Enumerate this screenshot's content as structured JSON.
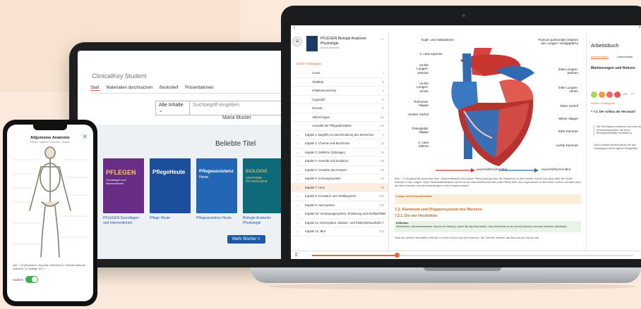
{
  "tablet": {
    "logo": "ClinicalKey",
    "logo_suffix": "Student",
    "nav": [
      "Start",
      "Materialien durchsuchen",
      "Bookshelf",
      "Präsentationen"
    ],
    "search_filter": "Alle Inhalte",
    "search_placeholder": "Suchbegriff eingeben",
    "user_name": "Maria Muster",
    "section_title": "Beliebte Titel",
    "books": [
      {
        "cover_title": "PFLEGEN",
        "cover_sub": "Grundlagen und Interventionen",
        "caption": "PFLEGEN Grundlagen und Interventionen",
        "color": "#6a2d85"
      },
      {
        "cover_title": "PflegeHeute",
        "cover_sub": "",
        "caption": "Pflege Heute",
        "color": "#1b4f9c"
      },
      {
        "cover_title": "Pflegeassistenz",
        "cover_sub": "Heute",
        "caption": "Pflegeassistenz Heute",
        "color": "#2366b5"
      },
      {
        "cover_title": "BIOLOGIE",
        "cover_sub": "ANATOMIE PHYSIOLOGIE",
        "caption": "Biologie Anatomie Physiologie",
        "color": "#0e6a78"
      }
    ],
    "more_button": "Mehr Bücher >"
  },
  "laptop": {
    "book_title": "PFLEGEN Biologie Anatomie Physiologie",
    "book_author": "Nicole Menche",
    "breadcrumb": "Inhalt > Einklappen",
    "toc": [
      {
        "label": "Cover",
        "page": "i",
        "type": "sub"
      },
      {
        "label": "Titelblatt",
        "page": "iii",
        "type": "sub"
      },
      {
        "label": "Inhaltsverzeichnis",
        "page": "v",
        "type": "sub"
      },
      {
        "label": "Copyright",
        "page": "iv",
        "type": "sub"
      },
      {
        "label": "Glossar",
        "page": "vi",
        "type": "sub"
      },
      {
        "label": "Abkürzungen",
        "page": "xix",
        "type": "sub"
      },
      {
        "label": "Auswahl der Pflegeaktivitäten",
        "page": "xxii",
        "type": "sub"
      },
      {
        "label": "Kapitel 1: Begriffe zur Beschreibung des Menschen",
        "page": "1",
        "type": "chapter"
      },
      {
        "label": "Kapitel 2: Chemie und Biochemie",
        "page": "13",
        "type": "chapter"
      },
      {
        "label": "Kapitel 3: Zelllehre (Zytologie)",
        "page": "35",
        "type": "chapter"
      },
      {
        "label": "Kapitel 4: Genetik und Evolution",
        "page": "55",
        "type": "chapter"
      },
      {
        "label": "Kapitel 5: Gewebe des Körpers",
        "page": "69",
        "type": "chapter"
      },
      {
        "label": "Kapitel 6: Immungesystem",
        "page": "93",
        "type": "chapter"
      },
      {
        "label": "Kapitel 7: Herz",
        "page": "99",
        "type": "chapter"
      },
      {
        "label": "Kapitel 8: Kreislauf- und Gefäßsystem",
        "page": "115",
        "type": "chapter"
      },
      {
        "label": "Kapitel 9: Atemsystem",
        "page": "133",
        "type": "chapter"
      },
      {
        "label": "Kapitel 10: Verdauungssystem, Ernährung und Stoffwechsel",
        "page": "151",
        "type": "chapter"
      },
      {
        "label": "Kapitel 11: Harnsystem, Wasser- und Elektrolythaushalt",
        "page": "189",
        "type": "chapter"
      },
      {
        "label": "Kapitel 12: Blut",
        "page": "213",
        "type": "chapter"
      }
    ],
    "heart_labels": {
      "l1": "Kopf- und Halsarterien",
      "l2": "V. cava superior",
      "l3": "rechte Lungen- arterien",
      "l4": "rechte Lungen- venen",
      "l5": "Pulmonal- klappe",
      "l6": "rechter Vorhof",
      "l7": "Trikuspidal- klappe",
      "l8": "V. cava inferior",
      "r1": "Truncus pulmonalis (Stamm der Lungen- schlagadern)",
      "r2": "linke Lungen- arterien",
      "r3": "linke Lungen- venen",
      "r4": "linker Vorhof",
      "r5": "Mitral- klappe",
      "r6": "linke Kammer",
      "r7": "rechte Kammer"
    },
    "legend_oxy": "sauerstoffreiches Blut",
    "legend_deoxy": "sauerstoffarmes Blut",
    "caption": "Abb. 7.3 Längsschnitt durch das Herz. Sauerstoffarmes Blut (blaue Pfeile) gelangt über die Hohlvenen in den rechten Vorhof und dann über die rechte Kammer in die Lungen. Nach Sauerstoffaufnahme strömt es als sauerstoffreiches Blut (rote Pfeile) über die Lungenvenen in den linken Vorhof und dann über die linke Kammer und den Aortenbogen in den Körperkreislauf",
    "box_title": "Lungen und Körperkreislauf",
    "section_heading": "7.2. Kammern und Klappensystem des Herzens",
    "sub_heading": "7.2.1. Die vier Herzhöhlen",
    "def_title": "Definition",
    "def_text": "Herzhöhlen: (Herzinnenräume; Kavum im Herzen), durch die das Blut strömt. Das Herzhöhle je ein Vorhof (Atrium) und eine Kammer (Ventrikel).",
    "body_text": "Jede der beiden Herzhälften teilt sich in einen Vorhof und eine Kammer. Die Vorhöfe nehmen das Blut aus den Venen auf.",
    "side_title": "Arbeitsbuch",
    "side_tabs": [
      "Anmerkungen",
      "Lesezeichen"
    ],
    "side_section": "Markierungen und Notizen",
    "side_crumb": "Inhalt > Einklappen",
    "side_item": "7.2. Der Aufbau der Herzwand",
    "side_note": "Die Herzklappen bestehen aus einer doppelten Endokardduplikatur, die durch Bindegewebsplatte verstärkt ist.",
    "side_note2": "Das Endokard besteht genau wie das Herzklappen keine eigenen Blutgefäße.",
    "dot_colors": [
      "#a6d854",
      "#f29c4a",
      "#f06a6a",
      "#e05a5a"
    ]
  },
  "phone": {
    "title": "Allgemeine Anatomie",
    "subtitle": "Skelett, Systeme erkunden, Notizen",
    "caption": "Abb. 1.15 [Illustration: Jörg Mair, München] In: Schünke Atlas der Anatomie, 24. Auflage, Bd. 1",
    "toggle_label": "Aus/An"
  }
}
